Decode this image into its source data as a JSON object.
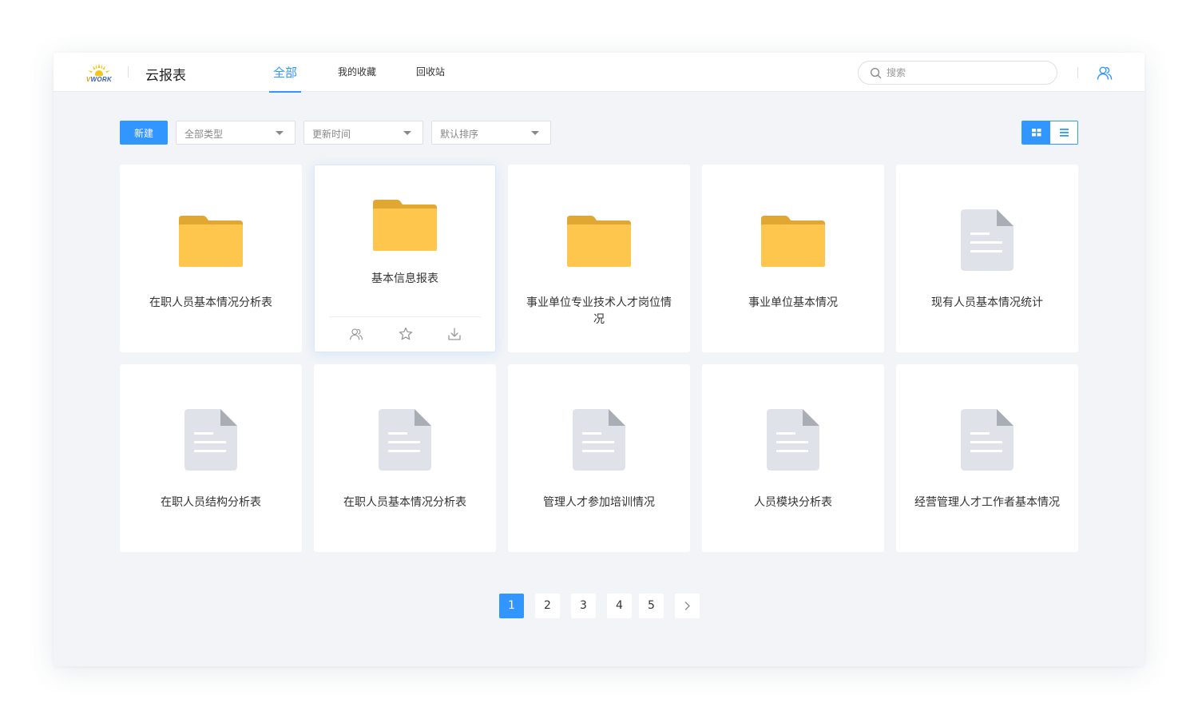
{
  "header": {
    "logo_text": "VWORK",
    "app_title": "云报表",
    "tabs": [
      {
        "label": "全部",
        "active": true
      },
      {
        "label": "我的收藏",
        "active": false
      },
      {
        "label": "回收站",
        "active": false
      }
    ],
    "search_placeholder": "搜索",
    "search_icon": "search-icon",
    "user_icon": "users-icon"
  },
  "toolbar": {
    "new_label": "新建",
    "filters": [
      {
        "label": "全部类型",
        "icon": "caret-down-icon"
      },
      {
        "label": "更新时间",
        "icon": "caret-down-icon"
      },
      {
        "label": "默认排序",
        "icon": "caret-down-icon"
      }
    ],
    "view_modes": [
      {
        "name": "grid",
        "icon": "grid-view-icon",
        "active": true
      },
      {
        "name": "list",
        "icon": "list-view-icon",
        "active": false
      }
    ]
  },
  "cards": [
    {
      "type": "folder",
      "name": "在职人员基本情况分析表"
    },
    {
      "type": "folder",
      "name": "基本信息报表",
      "hovered": true,
      "actions": [
        {
          "icon": "share-users-icon"
        },
        {
          "icon": "star-icon"
        },
        {
          "icon": "download-icon"
        }
      ]
    },
    {
      "type": "folder",
      "name": "事业单位专业技术人才岗位情况"
    },
    {
      "type": "folder",
      "name": "事业单位基本情况"
    },
    {
      "type": "document",
      "name": "现有人员基本情况统计"
    },
    {
      "type": "document",
      "name": "在职人员结构分析表"
    },
    {
      "type": "document",
      "name": "在职人员基本情况分析表"
    },
    {
      "type": "document",
      "name": "管理人才参加培训情况"
    },
    {
      "type": "document",
      "name": "人员模块分析表"
    },
    {
      "type": "document",
      "name": "经营管理人才工作者基本情况"
    }
  ],
  "pagination": {
    "pages": [
      "1",
      "2",
      "3",
      "4",
      "5"
    ],
    "current": "1",
    "next_icon": "chevron-right-icon"
  },
  "colors": {
    "accent": "#3196ff",
    "folder": "#ffc64d",
    "folder_tab": "#e0a732",
    "document": "#dfe2e8",
    "background": "#f2f4f7"
  }
}
